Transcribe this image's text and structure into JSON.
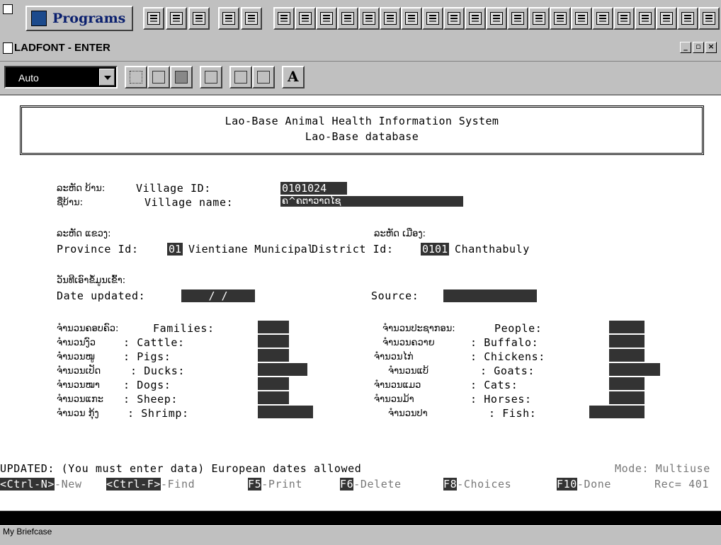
{
  "taskbar": {
    "programs_label": "Programs"
  },
  "window": {
    "title": "LADFONT - ENTER"
  },
  "toolbar": {
    "font_mode": "Auto",
    "font_button": "A"
  },
  "header": {
    "line1": "Lao-Base Animal Health Information System",
    "line2": "Lao-Base database"
  },
  "form": {
    "village_id_lao": "ລະຫັດ ບ້ານ:",
    "village_id_label": "Village ID:",
    "village_id_value": "0101024",
    "village_name_lao": "ຊື່ບ້ານ:",
    "village_name_label": "Village name:",
    "village_name_value": "ຄ^ຄຕາວາດໄຊ",
    "province_lao": "ລະຫັດ ແຂວງ:",
    "province_label": "Province Id:",
    "province_id": "01",
    "province_name": "Vientiane Municipal",
    "district_lao": "ລະຫັດ ເມືອງ:",
    "district_label": "District Id:",
    "district_id": "0101",
    "district_name": "Chanthabuly",
    "date_lao": "ວັນທີເອົາຂໍ້ມູນເຂົ້າ:",
    "date_label": "Date updated:",
    "date_value": " /  / ",
    "source_label": "Source:",
    "source_value": ""
  },
  "counts_left": [
    {
      "lao": "ຈຳນວນຄອບຄົວ:",
      "label": "Families:"
    },
    {
      "lao": "ຈຳນວນງົວ",
      "label": ": Cattle:"
    },
    {
      "lao": "ຈຳນວນໝູ",
      "label": ": Pigs:"
    },
    {
      "lao": "ຈຳນວນເປັດ",
      "label": ": Ducks:"
    },
    {
      "lao": "ຈຳນວນໝາ",
      "label": ": Dogs:"
    },
    {
      "lao": "ຈຳນວນແກະ",
      "label": ": Sheep:"
    },
    {
      "lao": "ຈຳນວນ ກຸ້ງ",
      "label": ": Shrimp:"
    }
  ],
  "counts_right": [
    {
      "lao": "ຈຳນວນປະຊາກອນ:",
      "label": "People:"
    },
    {
      "lao": "ຈຳນວນຄວາຍ",
      "label": ": Buffalo:"
    },
    {
      "lao": "ຈຳນວນໄກ່",
      "label": ": Chickens:"
    },
    {
      "lao": "ຈຳນວນແບ້",
      "label": ": Goats:"
    },
    {
      "lao": "ຈຳນວນແມວ",
      "label": ": Cats:"
    },
    {
      "lao": "ຈຳນວນມ້າ",
      "label": ": Horses:"
    },
    {
      "lao": "ຈຳນວນປາ",
      "label": ": Fish:"
    }
  ],
  "status": {
    "message": "UPDATED: (You must enter data) European dates allowed",
    "mode": "Mode: Multiuse"
  },
  "keys": [
    {
      "key": "<Ctrl-N>",
      "label": "-New"
    },
    {
      "key": "<Ctrl-F>",
      "label": "-Find"
    },
    {
      "key": "F5",
      "label": "-Print"
    },
    {
      "key": "F6",
      "label": "-Delete"
    },
    {
      "key": "F8",
      "label": "-Choices"
    },
    {
      "key": "F10",
      "label": "-Done"
    }
  ],
  "rec": "Rec= 401",
  "statusbar": {
    "text": "My Briefcase"
  }
}
